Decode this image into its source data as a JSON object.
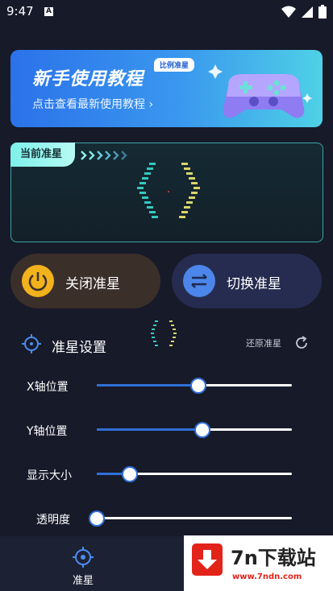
{
  "status_bar": {
    "time": "9:47",
    "badge": "A"
  },
  "banner": {
    "title": "新手使用教程",
    "subtitle": "点击查看最新使用教程",
    "chip": "比例准星"
  },
  "reticle_panel": {
    "tag": "当前准星",
    "arrows": ">>>>>>"
  },
  "buttons": {
    "close_label": "关闭准星",
    "switch_label": "切换准星"
  },
  "settings": {
    "title": "准星设置",
    "reset_label": "还原准星",
    "sliders": [
      {
        "label": "X轴位置",
        "value": 0.52
      },
      {
        "label": "Y轴位置",
        "value": 0.54
      },
      {
        "label": "显示大小",
        "value": 0.17
      },
      {
        "label": "透明度",
        "value": 0.0
      }
    ]
  },
  "bottom_nav": {
    "items": [
      {
        "label": "准星"
      }
    ]
  },
  "watermark": {
    "brand": "7n下载站",
    "url": "www.7ndn.com"
  },
  "colors": {
    "accent": "#2f6fd6",
    "teal": "#3aa6a8",
    "bg": "#171a29"
  }
}
